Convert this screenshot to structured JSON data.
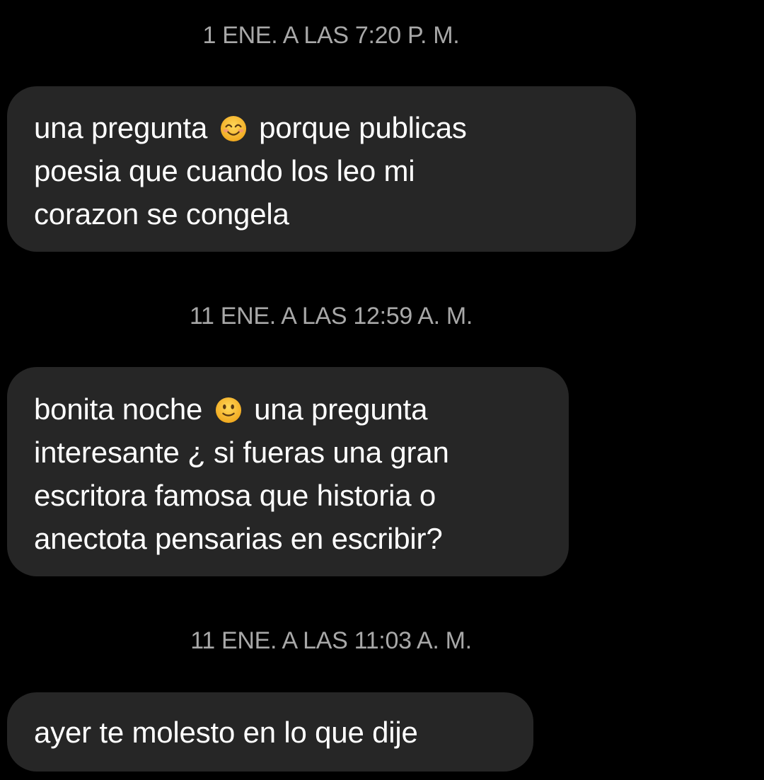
{
  "thread": {
    "timestamp_1": "1 ENE. A LAS 7:20 P. M.",
    "timestamp_2": "11 ENE. A LAS 12:59 A. M.",
    "timestamp_3": "11 ENE. A LAS 11:03 A. M.",
    "messages": [
      {
        "line_1_before_emoji": "una pregunta",
        "emoji": "smiling-face-with-smiling-eyes-icon",
        "line_1_after_emoji": "porque publicas",
        "line_2": "poesia que cuando los leo mi",
        "line_3": "corazon se congela"
      },
      {
        "line_1_before_emoji": "bonita noche",
        "emoji": "slightly-smiling-face-icon",
        "line_1_after_emoji": "una pregunta",
        "line_2": "interesante ¿ si fueras una gran",
        "line_3": "escritora famosa que historia o",
        "line_4": "anectota pensarias en escribir?"
      },
      {
        "line_1": "ayer te molesto en lo que dije"
      }
    ]
  },
  "colors": {
    "background": "#000000",
    "bubble": "#262626",
    "timestamp_text": "#a8a8a8",
    "message_text": "#ffffff",
    "emoji_face": "#f7c23a"
  }
}
